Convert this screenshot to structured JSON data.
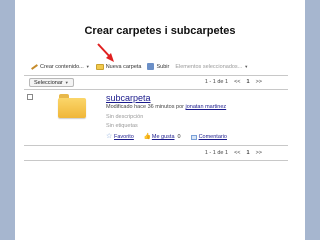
{
  "slide_title": "Crear carpetes i subcarpetes",
  "toolbar": {
    "create_label": "Crear contenido...",
    "new_folder_label": "Nueva carpeta",
    "upload_label": "Subir",
    "selected_items_label": "Elementos seleccionados..."
  },
  "pager": {
    "range": "1 - 1 de 1",
    "first": "<<",
    "current": "1",
    "last": ">>"
  },
  "select_button": "Seleccionar",
  "item": {
    "name": "subcarpeta",
    "modified_prefix": "Modificado hace 36 minutos por",
    "modified_by": "jonatan martinez",
    "description": "Sin descripción",
    "tags": "Sin etiquetas",
    "favorite_label": "Favorito",
    "like_label": "Me gusta",
    "like_count": "0",
    "comment_label": "Comentario"
  },
  "colors": {
    "side_bar": "#a6b6cf",
    "arrow": "#e02020",
    "link": "#1a1a8c"
  }
}
